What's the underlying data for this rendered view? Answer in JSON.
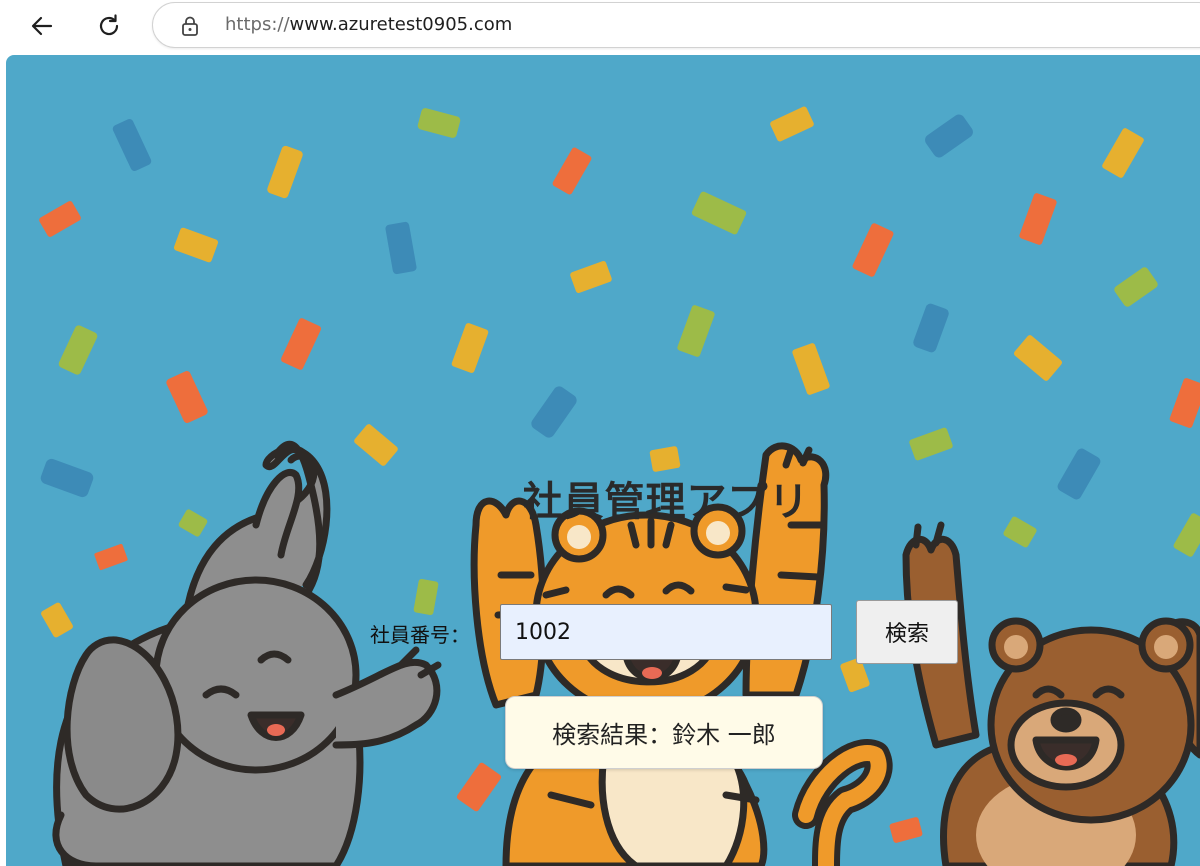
{
  "browser": {
    "url_scheme": "https://",
    "url_host": "www.azuretest0905.com"
  },
  "page": {
    "title": "社員管理アプリ",
    "employee_label": "社員番号：",
    "employee_input_value": "1002",
    "search_button": "検索",
    "result_text": "検索結果：鈴木 一郎"
  },
  "illustration": {
    "background_color": "#4fa8c9",
    "characters": [
      "elephant",
      "tiger",
      "bear"
    ],
    "confetti_colors": [
      "#ee6e3c",
      "#e6b02f",
      "#9dbb48",
      "#3d8bb7"
    ]
  }
}
